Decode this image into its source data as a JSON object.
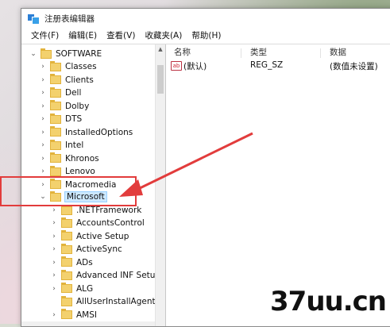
{
  "window": {
    "title": "注册表编辑器"
  },
  "menu": [
    "文件(F)",
    "编辑(E)",
    "查看(V)",
    "收藏夹(A)",
    "帮助(H)"
  ],
  "tree": {
    "root": "SOFTWARE",
    "items": [
      "Classes",
      "Clients",
      "Dell",
      "Dolby",
      "DTS",
      "InstalledOptions",
      "Intel",
      "Khronos",
      "Lenovo",
      "Macromedia"
    ],
    "selected": "Microsoft",
    "children": [
      ".NETFramework",
      "AccountsControl",
      "Active Setup",
      "ActiveSync",
      "ADs",
      "Advanced INF Setup",
      "ALG",
      "AllUserInstallAgent",
      "AMSI"
    ]
  },
  "list": {
    "columns": [
      "名称",
      "类型",
      "数据"
    ],
    "rows": [
      {
        "name": "(默认)",
        "type": "REG_SZ",
        "data": "(数值未设置)"
      }
    ]
  },
  "value_icon": "ab",
  "watermark": "37uu.cn",
  "colors": {
    "highlight": "#e23c3c",
    "folder": "#f3d16e",
    "selection": "#cce8ff"
  },
  "icons": [
    "registry-editor-icon",
    "folder-icon",
    "chevron-right-icon",
    "chevron-down-icon",
    "string-value-icon"
  ]
}
